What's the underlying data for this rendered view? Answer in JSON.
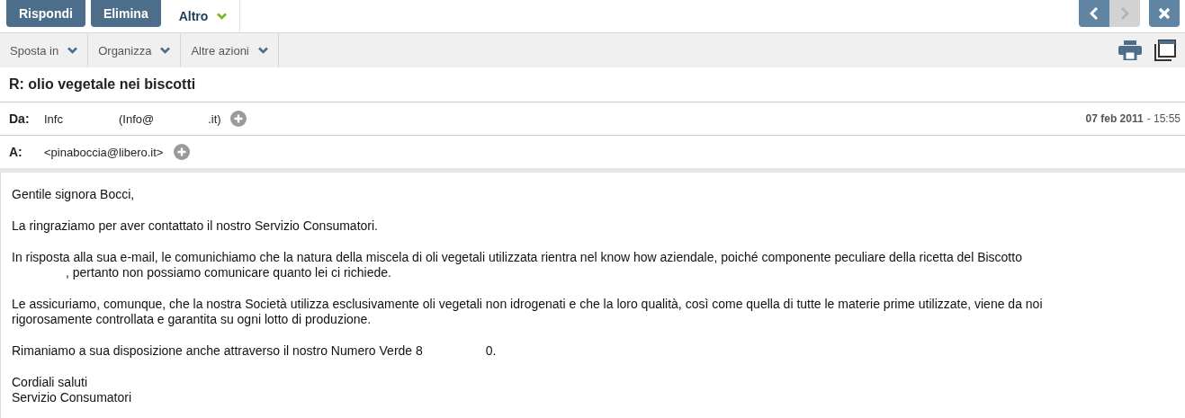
{
  "top_buttons": [
    {
      "label": "Rispondi",
      "kind": "primary"
    },
    {
      "label": "Elimina",
      "kind": "primary"
    },
    {
      "label": "Altro",
      "kind": "menu"
    }
  ],
  "nav": {
    "prev_disabled": false,
    "next_disabled": true
  },
  "toolbar": [
    "Sposta in",
    "Organizza",
    "Altre azioni"
  ],
  "subject": "R: olio vegetale nei biscotti",
  "from": {
    "label": "Da:",
    "parts": [
      "Infc",
      "(Info@",
      ".it)"
    ],
    "date": "07 feb 2011",
    "time": "- 15:55"
  },
  "to": {
    "label": "A:",
    "address": "<pinaboccia@libero.it>"
  },
  "body": [
    {
      "lines": [
        "Gentile signora Bocci,"
      ]
    },
    {
      "lines": [
        "La ringraziamo per aver contattato il nostro Servizio Consumatori."
      ]
    },
    {
      "lines": [
        "In risposta alla sua e-mail, le comunichiamo che la natura della miscela di oli vegetali utilizzata rientra nel know how aziendale, poiché componente peculiare della ricetta del Biscotto",
        ", pertanto non possiamo comunicare quanto lei ci richiede."
      ]
    },
    {
      "lines": [
        "Le assicuriamo, comunque, che la nostra Società utilizza esclusivamente oli vegetali non idrogenati e che la loro qualità, così come quella di tutte le materie prime utilizzate, viene da noi",
        "rigorosamente controllata e garantita su ogni lotto di produzione."
      ]
    },
    {
      "lines": [
        "Rimaniamo a sua disposizione anche attraverso il nostro Numero Verde 8",
        "0."
      ]
    },
    {
      "lines": [
        "Cordiali saluti",
        "Servizio Consumatori"
      ]
    }
  ]
}
